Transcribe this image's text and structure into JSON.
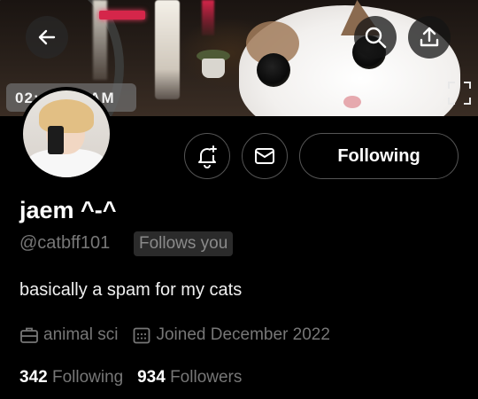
{
  "banner": {
    "timestamp": "02:          AM"
  },
  "header": {
    "back_icon": "arrow-left-icon",
    "search_icon": "search-icon",
    "share_icon": "share-upload-icon",
    "expand_icon": "scan-frame-icon"
  },
  "actions": {
    "notify_icon": "bell-plus-icon",
    "message_icon": "envelope-icon",
    "following_label": "Following"
  },
  "profile": {
    "display_name": "jaem ^-^",
    "handle": "@catbff101",
    "follows_you": "Follows you",
    "bio": "basically a spam for my cats",
    "profession": "animal sci",
    "joined": "Joined December 2022",
    "following_count": "342",
    "following_label": "Following",
    "followers_count": "934",
    "followers_label": "Followers"
  },
  "colors": {
    "background": "#000000",
    "text_primary": "#ffffff",
    "text_secondary": "#777777",
    "button_border": "#555555",
    "badge_background": "#2b2b2b"
  }
}
